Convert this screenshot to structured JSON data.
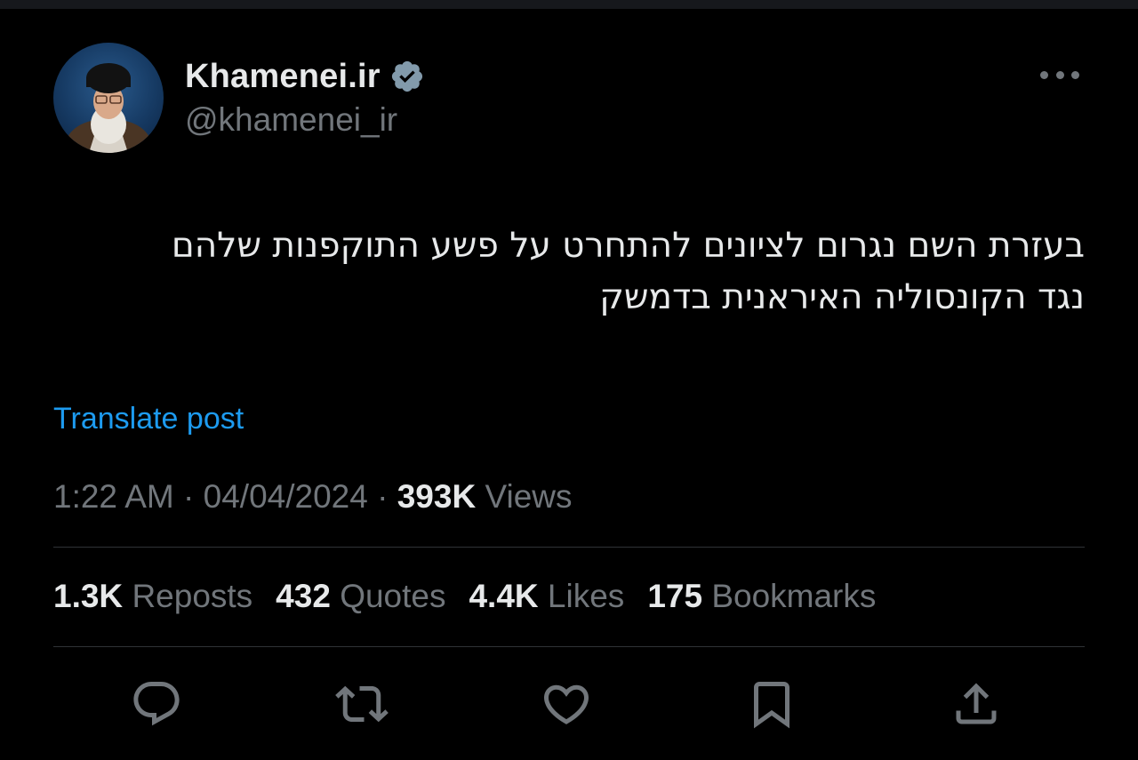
{
  "author": {
    "display_name": "Khamenei.ir",
    "handle": "@khamenei_ir",
    "verified": true,
    "avatar_icon": "profile-photo"
  },
  "tweet": {
    "text_lines": [
      "בעזרת השם נגרום לציונים להתחרט על פשע התוקפנות שלהם",
      "נגד הקונסוליה האיראנית בדמשק"
    ],
    "translate_label": "Translate post"
  },
  "meta": {
    "time": "1:22 AM",
    "separator": "·",
    "date": "04/04/2024",
    "views_count": "393K",
    "views_label": "Views"
  },
  "stats": {
    "reposts": {
      "count": "1.3K",
      "label": "Reposts"
    },
    "quotes": {
      "count": "432",
      "label": "Quotes"
    },
    "likes": {
      "count": "4.4K",
      "label": "Likes"
    },
    "bookmarks": {
      "count": "175",
      "label": "Bookmarks"
    }
  },
  "actions": [
    "reply-icon",
    "repost-icon",
    "like-icon",
    "bookmark-icon",
    "share-icon"
  ],
  "colors": {
    "background": "#000000",
    "text": "#e7e9ea",
    "secondary": "#71767b",
    "link": "#1d9bf0",
    "divider": "#2f3336"
  }
}
